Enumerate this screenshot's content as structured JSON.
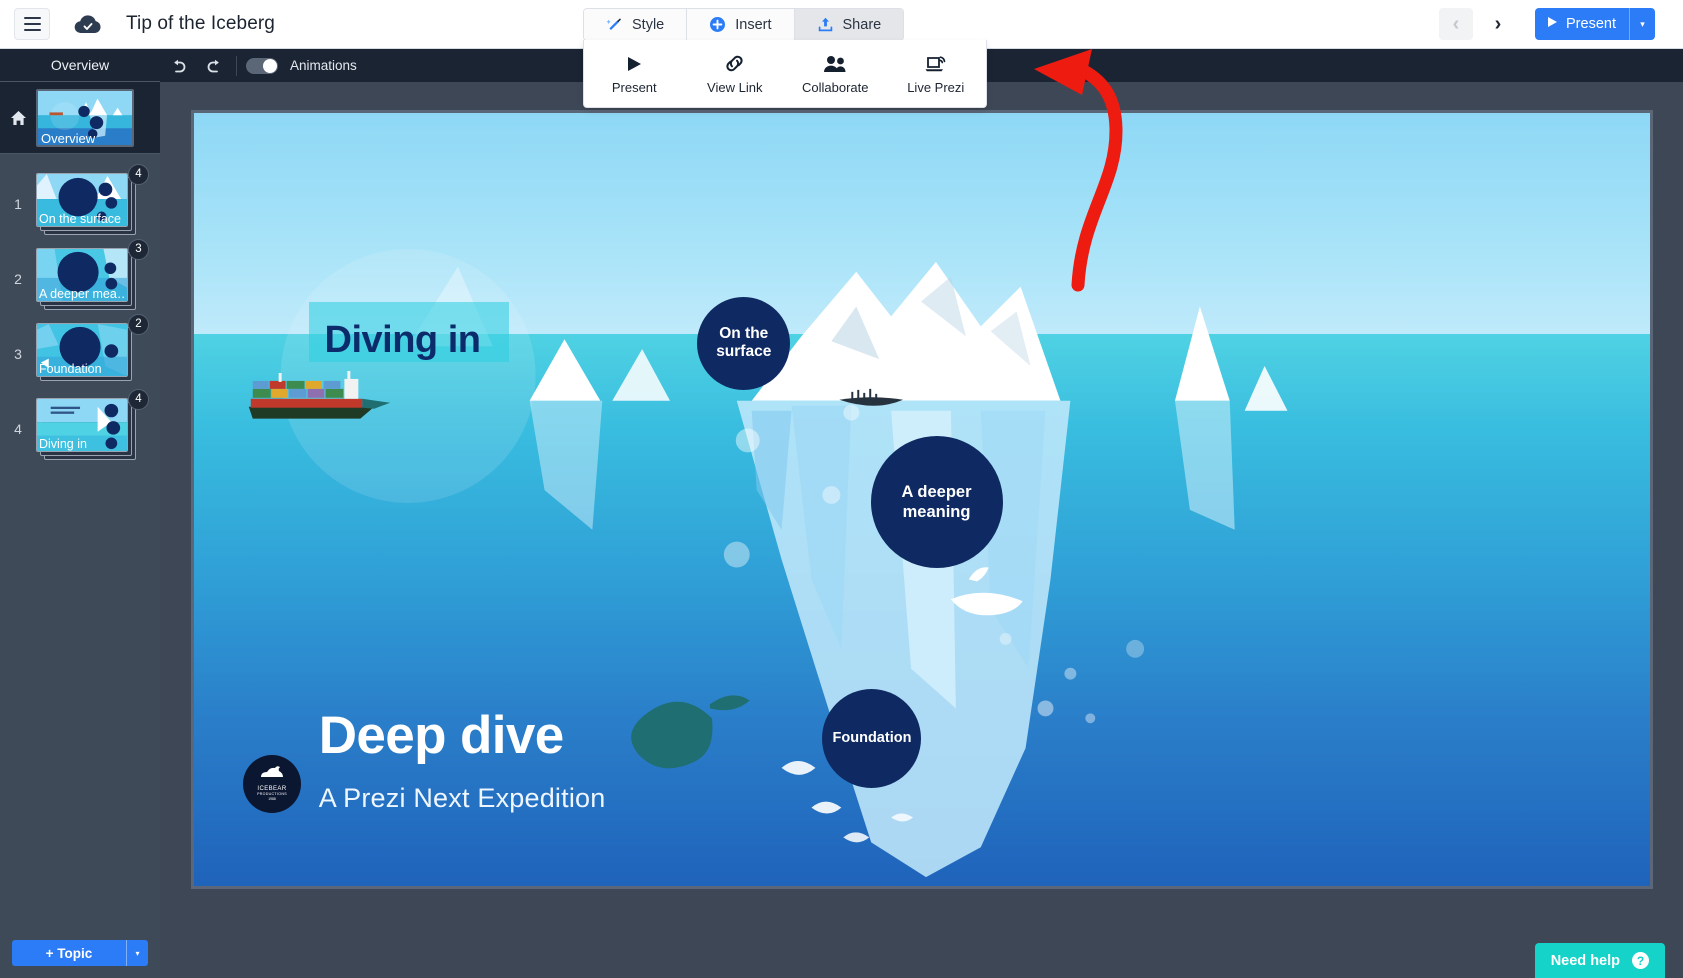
{
  "topbar": {
    "menu_icon": "hamburger-icon",
    "cloud_icon": "cloud-saved-icon",
    "title": "Tip of the Iceberg",
    "tabs": [
      {
        "label": "Style",
        "icon": "magic-wand-icon",
        "active": false
      },
      {
        "label": "Insert",
        "icon": "plus-circle-icon",
        "active": false
      },
      {
        "label": "Share",
        "icon": "upload-icon",
        "active": true
      }
    ],
    "prev_label": "‹",
    "next_label": "›",
    "present_label": "Present",
    "present_caret": "▾"
  },
  "share_menu": {
    "items": [
      {
        "label": "Present",
        "icon": "play-icon"
      },
      {
        "label": "View Link",
        "icon": "link-icon"
      },
      {
        "label": "Collaborate",
        "icon": "people-icon"
      },
      {
        "label": "Live Prezi",
        "icon": "laptop-broadcast-icon"
      }
    ]
  },
  "editor_toolbar": {
    "undo_icon": "undo-arrow-icon",
    "redo_icon": "redo-arrow-icon",
    "animations_label": "Animations",
    "animations_on": true
  },
  "sidebar": {
    "header": "Overview",
    "home_icon": "home-icon",
    "overview_label": "Overview",
    "slides": [
      {
        "num": "1",
        "title": "On the surface",
        "badge": "4"
      },
      {
        "num": "2",
        "title": "A deeper mea…",
        "badge": "3"
      },
      {
        "num": "3",
        "title": "Foundation",
        "badge": "2"
      },
      {
        "num": "4",
        "title": "Diving in",
        "badge": "4"
      }
    ],
    "add_topic_label": "+ Topic",
    "add_topic_caret": "▾"
  },
  "canvas": {
    "diving_in": "Diving in",
    "bubbles": [
      {
        "label": "On the\nsurface"
      },
      {
        "label": "A deeper\nmeaning"
      },
      {
        "label": "Foundation"
      }
    ],
    "title": "Deep dive",
    "subtitle": "A Prezi Next Expedition",
    "logo": {
      "name": "ICEBEAR",
      "sub": "PRODUCTIONS",
      "year": "1988",
      "icon": "polar-bear-icon"
    }
  },
  "need_help": {
    "label": "Need help",
    "icon": "question-mark-icon"
  },
  "annotation": {
    "arrow": "red-arrow-pointing-to-live-prezi"
  },
  "colors": {
    "accent_blue": "#2b7cf6",
    "navy": "#0f2a63",
    "teal": "#15d3c8",
    "sidebar_bg": "#3f4a59",
    "toolbar_dark": "#1b2433",
    "annotation_red": "#ee1b11"
  }
}
